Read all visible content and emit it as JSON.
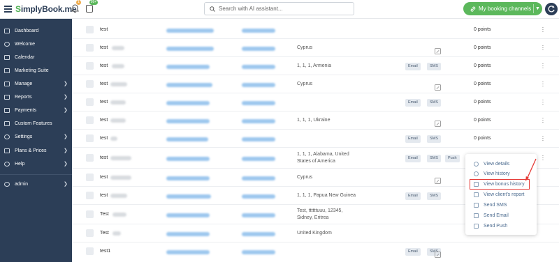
{
  "header": {
    "logo_text": "implyBook.me",
    "logo_initial": "S",
    "notification_badge": "1",
    "tasks_badge": "99+",
    "search_placeholder": "Search with AI assistant...",
    "booking_button_label": "My booking channels"
  },
  "sidebar": {
    "items": [
      {
        "label": "Dashboard",
        "icon": "dashboard-icon",
        "arrow": false
      },
      {
        "label": "Welcome",
        "icon": "pin-icon",
        "arrow": false
      },
      {
        "label": "Calendar",
        "icon": "calendar-icon",
        "arrow": false
      },
      {
        "label": "Marketing Suite",
        "icon": "megaphone-icon",
        "arrow": false
      },
      {
        "label": "Manage",
        "icon": "wrench-icon",
        "arrow": true
      },
      {
        "label": "Reports",
        "icon": "chart-icon",
        "arrow": true
      },
      {
        "label": "Payments",
        "icon": "card-icon",
        "arrow": true
      },
      {
        "label": "Custom Features",
        "icon": "puzzle-icon",
        "arrow": false
      },
      {
        "label": "Settings",
        "icon": "gear-icon",
        "arrow": true
      },
      {
        "label": "Plans & Prices",
        "icon": "tag-icon",
        "arrow": true
      },
      {
        "label": "Help",
        "icon": "help-icon",
        "arrow": true
      }
    ],
    "user": {
      "label": "admin",
      "icon": "user-icon"
    }
  },
  "table": {
    "rows": [
      {
        "name": "test",
        "address": "",
        "tags": [],
        "points": "0 points"
      },
      {
        "name": "test",
        "address": "Cyprus",
        "tags": [],
        "points": "0 points"
      },
      {
        "name": "test",
        "address": "1, 1, 1, Armenia",
        "tags": [
          "Email",
          "SMS"
        ],
        "points": "0 points"
      },
      {
        "name": "test",
        "address": "Cyprus",
        "tags": [],
        "points": "0 points"
      },
      {
        "name": "test",
        "address": "",
        "tags": [
          "Email",
          "SMS"
        ],
        "points": "0 points"
      },
      {
        "name": "test",
        "address": "1, 1, 1, Ukraine",
        "tags": [],
        "points": "0 points"
      },
      {
        "name": "test",
        "address": "",
        "tags": [
          "Email",
          "SMS"
        ],
        "points": "0 points"
      },
      {
        "name": "test",
        "address": "1, 1, 1, Alabama, United States of America",
        "tags": [
          "Email",
          "SMS",
          "Push"
        ],
        "points": ""
      },
      {
        "name": "test",
        "address": "Cyprus",
        "tags": [],
        "points": ""
      },
      {
        "name": "test",
        "address": "1, 1, 1, Papua New Guinea",
        "tags": [
          "Email",
          "SMS"
        ],
        "points": ""
      },
      {
        "name": "Test",
        "address": "Test, ttttttuuu, 12345, Sidney, Eritrea",
        "tags": [],
        "points": ""
      },
      {
        "name": "Test",
        "address": "United Kingdom",
        "tags": [],
        "points": ""
      },
      {
        "name": "test1",
        "address": "",
        "tags": [
          "Email",
          "SMS"
        ],
        "points": ""
      }
    ]
  },
  "context_menu": {
    "items": [
      {
        "label": "View details",
        "icon": "eye-icon"
      },
      {
        "label": "View history",
        "icon": "history-icon"
      },
      {
        "label": "View bonus history",
        "icon": "bonus-icon",
        "highlighted": true
      },
      {
        "label": "View client's report",
        "icon": "report-icon"
      },
      {
        "label": "Send SMS",
        "icon": "sms-icon"
      },
      {
        "label": "Send Email",
        "icon": "email-icon"
      },
      {
        "label": "Send Push",
        "icon": "push-icon"
      }
    ]
  },
  "colors": {
    "sidebar_bg": "#2c3e57",
    "accent_green": "#5cb85c",
    "highlight_red": "#e53935",
    "tag_bg": "#e4e9ef"
  }
}
